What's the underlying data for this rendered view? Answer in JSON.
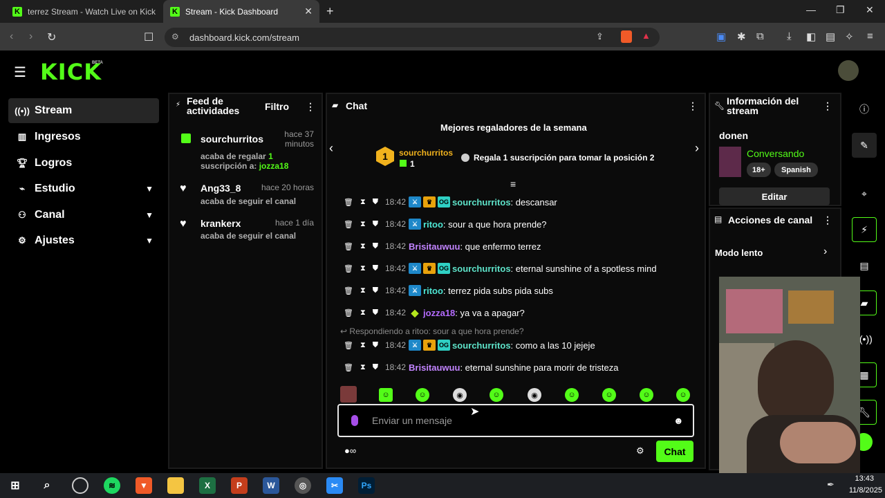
{
  "browser": {
    "tabs": [
      {
        "label": "terrez Stream - Watch Live on Kick"
      },
      {
        "label": "Stream - Kick Dashboard"
      }
    ],
    "url": "dashboard.kick.com/stream"
  },
  "header": {
    "logo": "KICK",
    "beta": "BETA"
  },
  "sidebar": {
    "items": [
      {
        "label": "Stream",
        "icon": "stream-icon"
      },
      {
        "label": "Ingresos",
        "icon": "chart-icon"
      },
      {
        "label": "Logros",
        "icon": "trophy-icon"
      },
      {
        "label": "Estudio",
        "icon": "studio-icon"
      },
      {
        "label": "Canal",
        "icon": "channel-icon"
      },
      {
        "label": "Ajustes",
        "icon": "gear-icon"
      }
    ]
  },
  "feed": {
    "title": "Feed de actividades",
    "filter": "Filtro",
    "items": [
      {
        "name": "sourchurritos",
        "time": "hace 37 minutos",
        "text1": "acaba de regalar ",
        "count": "1",
        "text2": "suscripción a: ",
        "target": "jozza18"
      },
      {
        "name": "Ang33_8",
        "time": "hace 20 horas",
        "text": "acaba de seguir el canal"
      },
      {
        "name": "krankerx",
        "time": "hace 1 día",
        "text": "acaba de seguir el canal"
      }
    ]
  },
  "chat": {
    "title": "Chat",
    "top_gifters_title": "Mejores regaladores de la semana",
    "top_gifter": {
      "rank": "1",
      "name": "sourchurritos",
      "count": "1"
    },
    "cta": "Regala 1 suscripción para tomar la posición 2",
    "messages": [
      {
        "time": "18:42",
        "user": "sourchurritos",
        "text": ": descansar"
      },
      {
        "time": "18:42",
        "user": "ritoo",
        "text": ": sour a que hora prende?"
      },
      {
        "time": "18:42",
        "user": "Brisitauwuu",
        "text": ": que enfermo terrez"
      },
      {
        "time": "18:42",
        "user": "sourchurritos",
        "text": ": eternal sunshine of a spotless mind"
      },
      {
        "time": "18:42",
        "user": "ritoo",
        "text": ": terrez pida subs pida subs"
      },
      {
        "time": "18:42",
        "user": "jozza18",
        "text": ": ya va a apagar?"
      },
      {
        "time": "18:42",
        "user": "sourchurritos",
        "text": ": como a las 10 jejeje"
      },
      {
        "time": "18:42",
        "user": "Brisitauwuu",
        "text": ": eternal sunshine para morir de tristeza"
      }
    ],
    "reply_note": "Respondiendo a ritoo: sour a que hora prende?",
    "placeholder": "Enviar un mensaje",
    "send_label": "Chat"
  },
  "info": {
    "title": "Información del stream",
    "stream_title": "donen",
    "category": "Conversando",
    "tags": [
      "18+",
      "Spanish"
    ],
    "edit_label": "Editar"
  },
  "actions": {
    "title": "Acciones de canal",
    "slow_mode": "Modo lento"
  },
  "taskbar": {
    "time": "13:43",
    "date": "11/8/2025"
  },
  "colors": {
    "brand": "#53fc18",
    "panel": "#0b0b0b"
  }
}
